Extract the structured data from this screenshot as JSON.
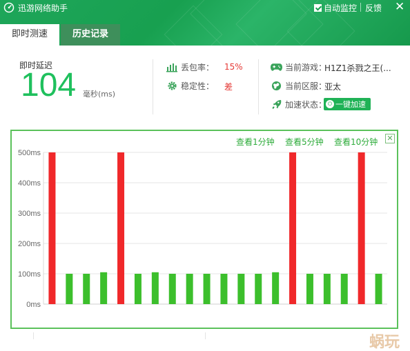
{
  "window": {
    "title": "迅游网络助手",
    "auto_monitor_label": "自动监控",
    "auto_monitor_checked": true,
    "feedback_label": "反馈",
    "close_glyph": "✕"
  },
  "tabs": [
    {
      "label": "即时测速",
      "active": true
    },
    {
      "label": "历史记录",
      "active": false
    }
  ],
  "latency": {
    "label": "即时延迟",
    "value": "104",
    "unit": "毫秒(ms)"
  },
  "stats": {
    "packet_loss_label": "丢包率：",
    "packet_loss_value": "15%",
    "stability_label": "稳定性：",
    "stability_value": "差",
    "current_game_label": "当前游戏：",
    "current_game_value": "H1Z1杀戮之王(...",
    "current_region_label": "当前区服：",
    "current_region_value": "亚太",
    "boost_status_label": "加速状态：",
    "boost_button_label": "一键加速"
  },
  "chart_panel": {
    "links": [
      "查看1分钟",
      "查看5分钟",
      "查看10分钟"
    ],
    "close_glyph": "✕"
  },
  "colors": {
    "brand_green": "#1fa85a",
    "bar_red": "#f0282a",
    "bar_green": "#3cbf2c",
    "latency_green": "#1fc05d",
    "panel_border": "#5ac15a"
  },
  "chart_data": {
    "type": "bar",
    "ylabel": "",
    "xlabel": "",
    "ylim": [
      0,
      500
    ],
    "yticks": [
      "0ms",
      "100ms",
      "200ms",
      "300ms",
      "400ms",
      "500ms"
    ],
    "grid": true,
    "values": [
      500,
      100,
      100,
      105,
      500,
      100,
      105,
      100,
      100,
      100,
      100,
      100,
      100,
      105,
      500,
      100,
      100,
      100,
      500,
      100
    ],
    "status": [
      "loss",
      "ok",
      "ok",
      "ok",
      "loss",
      "ok",
      "ok",
      "ok",
      "ok",
      "ok",
      "ok",
      "ok",
      "ok",
      "ok",
      "loss",
      "ok",
      "ok",
      "ok",
      "loss",
      "ok"
    ]
  }
}
